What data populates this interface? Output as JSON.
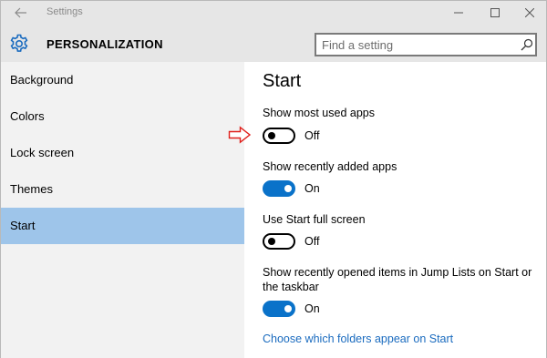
{
  "window": {
    "title": "Settings"
  },
  "header": {
    "title": "PERSONALIZATION",
    "search_placeholder": "Find a setting"
  },
  "sidebar": {
    "items": [
      {
        "label": "Background"
      },
      {
        "label": "Colors"
      },
      {
        "label": "Lock screen"
      },
      {
        "label": "Themes"
      },
      {
        "label": "Start"
      }
    ],
    "selected": "Start"
  },
  "content": {
    "title": "Start",
    "settings": [
      {
        "label": "Show most used apps",
        "state": "Off"
      },
      {
        "label": "Show recently added apps",
        "state": "On"
      },
      {
        "label": "Use Start full screen",
        "state": "Off"
      },
      {
        "label": "Show recently opened items in Jump Lists on Start or the taskbar",
        "state": "On"
      }
    ],
    "link": "Choose which folders appear on Start"
  },
  "colors": {
    "accent": "#0a72c9",
    "selected_nav": "#9ec5ea",
    "link": "#1a6bbf",
    "annotation_arrow": "#e0201c"
  },
  "icons": {
    "back": "back-arrow-icon",
    "gear": "gear-icon",
    "search": "search-icon",
    "minimize": "minimize-icon",
    "maximize": "maximize-icon",
    "close": "close-icon",
    "annotation": "red-arrow-icon"
  }
}
